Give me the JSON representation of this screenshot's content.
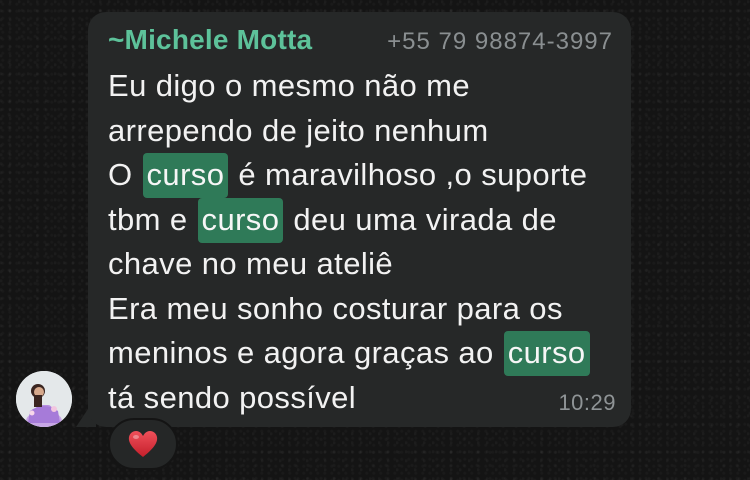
{
  "message": {
    "sender_name": "~Michele Motta",
    "sender_phone": "+55 79 98874-3997",
    "lines": [
      [
        {
          "t": "Eu digo o mesmo não me"
        }
      ],
      [
        {
          "t": "arrependo de jeito nenhum"
        }
      ],
      [
        {
          "t": "O "
        },
        {
          "t": "curso",
          "hl": true
        },
        {
          "t": " é maravilhoso ,o suporte"
        }
      ],
      [
        {
          "t": "tbm e "
        },
        {
          "t": "curso",
          "hl": true
        },
        {
          "t": " deu uma virada de"
        }
      ],
      [
        {
          "t": "chave no meu ateliê"
        }
      ],
      [
        {
          "t": "Era meu sonho costurar para os"
        }
      ],
      [
        {
          "t": "meninos e agora graças ao "
        },
        {
          "t": "curso",
          "hl": true
        }
      ],
      [
        {
          "t": "tá sendo possível"
        }
      ]
    ],
    "time": "10:29",
    "reaction": "heart-emoji"
  },
  "colors": {
    "background": "#141414",
    "bubble": "#262828",
    "sender_name": "#5dc29a",
    "phone": "#8a8f91",
    "text": "#f2f2f2",
    "search_highlight": "#2f7a58",
    "reaction_heart": "#e0313b"
  }
}
